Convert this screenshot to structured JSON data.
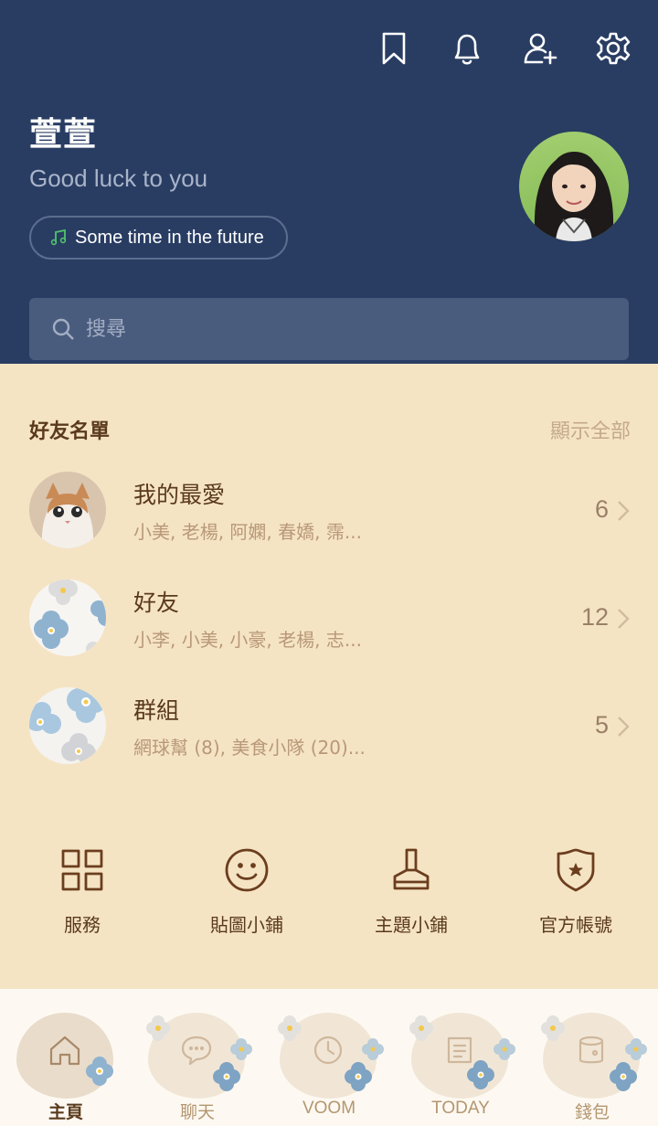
{
  "header": {
    "profile_name": "萱萱",
    "status_message": "Good luck to you",
    "music": "Some time in the future",
    "icons": [
      "bookmark-icon",
      "bell-icon",
      "add-friend-icon",
      "gear-icon"
    ]
  },
  "search": {
    "placeholder": "搜尋"
  },
  "friends": {
    "title": "好友名單",
    "show_all": "顯示全部",
    "rows": [
      {
        "title": "我的最愛",
        "subtitle": "小美, 老楊, 阿嫻, 春嬌, 霈...",
        "count": "6"
      },
      {
        "title": "好友",
        "subtitle": "小李, 小美, 小豪, 老楊, 志...",
        "count": "12"
      },
      {
        "title": "群組",
        "subtitle": "網球幫 (8), 美食小隊 (20)...",
        "count": "5"
      }
    ]
  },
  "shortcuts": [
    {
      "label": "服務",
      "icon": "grid-icon"
    },
    {
      "label": "貼圖小鋪",
      "icon": "smiley-icon"
    },
    {
      "label": "主題小鋪",
      "icon": "brush-icon"
    },
    {
      "label": "官方帳號",
      "icon": "shield-star-icon"
    }
  ],
  "nav": [
    {
      "label": "主頁",
      "icon": "home-icon",
      "active": true
    },
    {
      "label": "聊天",
      "icon": "chat-icon"
    },
    {
      "label": "VOOM",
      "icon": "clock-icon"
    },
    {
      "label": "TODAY",
      "icon": "news-icon"
    },
    {
      "label": "錢包",
      "icon": "wallet-icon"
    }
  ],
  "colors": {
    "header_bg": "#293d63",
    "body_bg": "#f5e4c4",
    "text_brown": "#5a3a1c",
    "music_note": "#4fc36a"
  }
}
